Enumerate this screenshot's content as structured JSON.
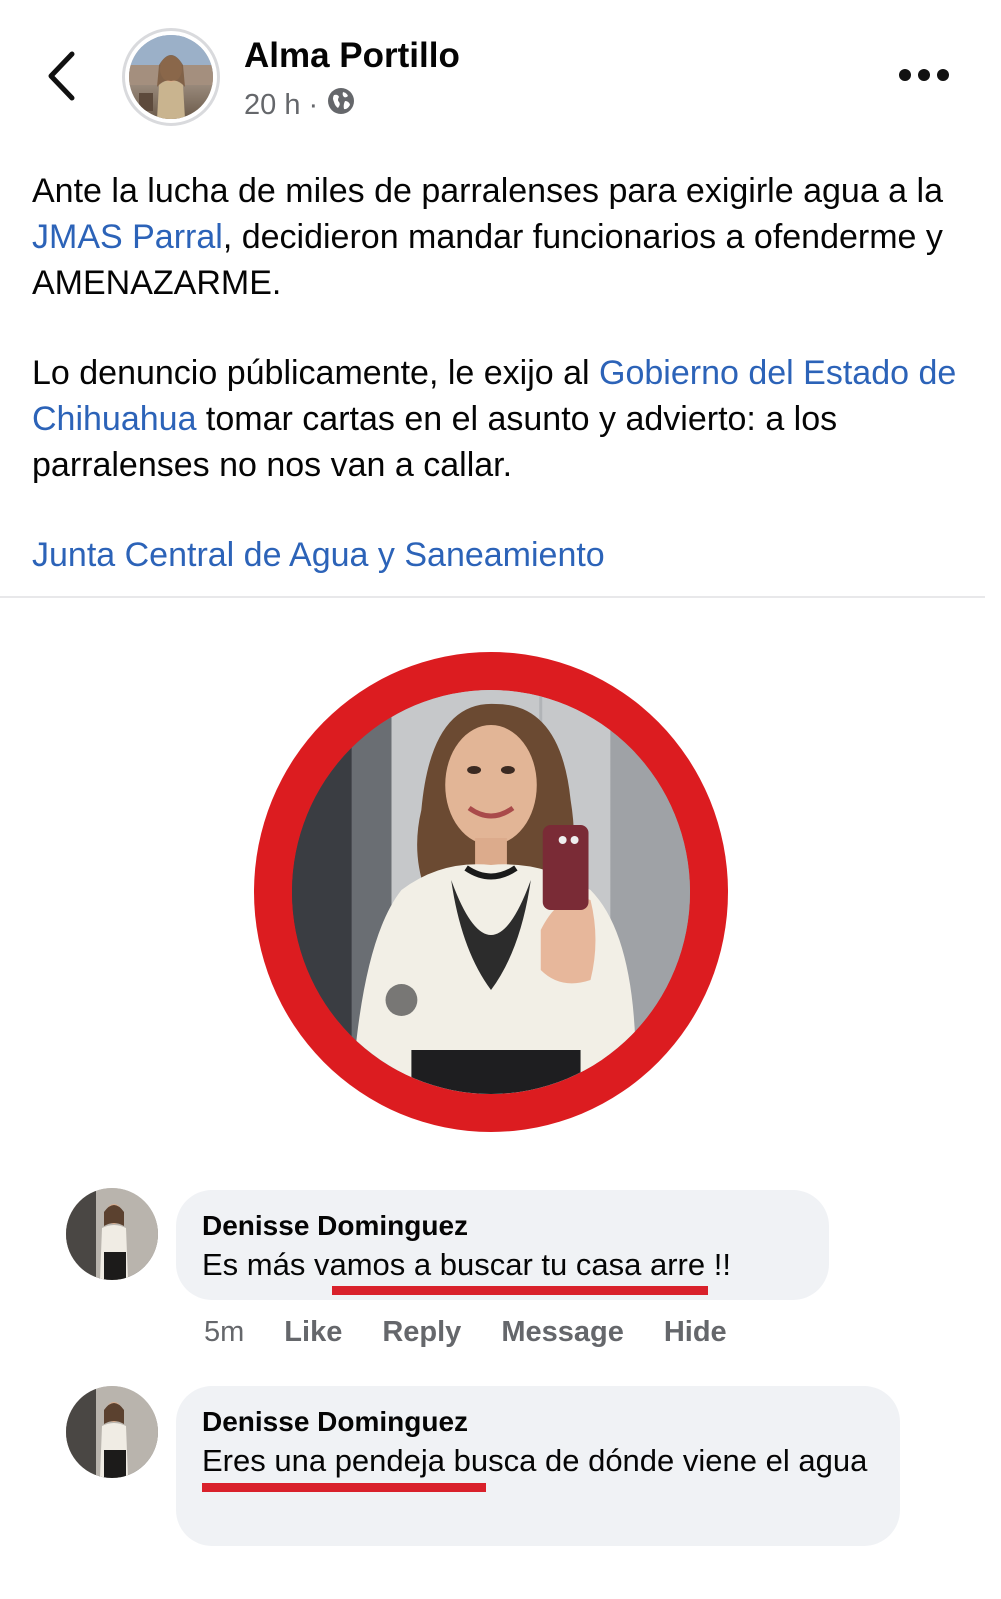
{
  "header": {
    "author_name": "Alma Portillo",
    "timestamp": "20 h",
    "separator": "·",
    "audience_icon": "globe-icon",
    "back_icon": "chevron-left-icon",
    "more_icon": "more-horizontal-icon"
  },
  "post": {
    "p1_before": "Ante la lucha de miles de parralenses para exigirle agua a la ",
    "p1_link": "JMAS Parral",
    "p1_after": ", decidieron mandar funcionarios a ofenderme y AMENAZARME.",
    "p2_before": "Lo denuncio públicamente, le exijo al ",
    "p2_link": "Gobierno del Estado de Chihuahua",
    "p2_after": " tomar cartas en el asunto y advierto: a los parralenses no nos van a callar.",
    "p3_link": "Junta Central de Agua y Saneamiento"
  },
  "colors": {
    "link": "#2c63b8",
    "ring": "#dc1c20",
    "underline": "#d9212b",
    "bubble": "#f0f2f5",
    "meta": "#65676b"
  },
  "comments": [
    {
      "author": "Denisse Dominguez",
      "text_before": "Es más ",
      "text_marked": "vamos a buscar tu casa",
      "text_after": " arre !!",
      "time": "5m",
      "actions": [
        "Like",
        "Reply",
        "Message",
        "Hide"
      ]
    },
    {
      "author": "Denisse Dominguez",
      "text_marked": "Eres una pendeja",
      "text_after": " busca de dónde viene el agua"
    }
  ]
}
